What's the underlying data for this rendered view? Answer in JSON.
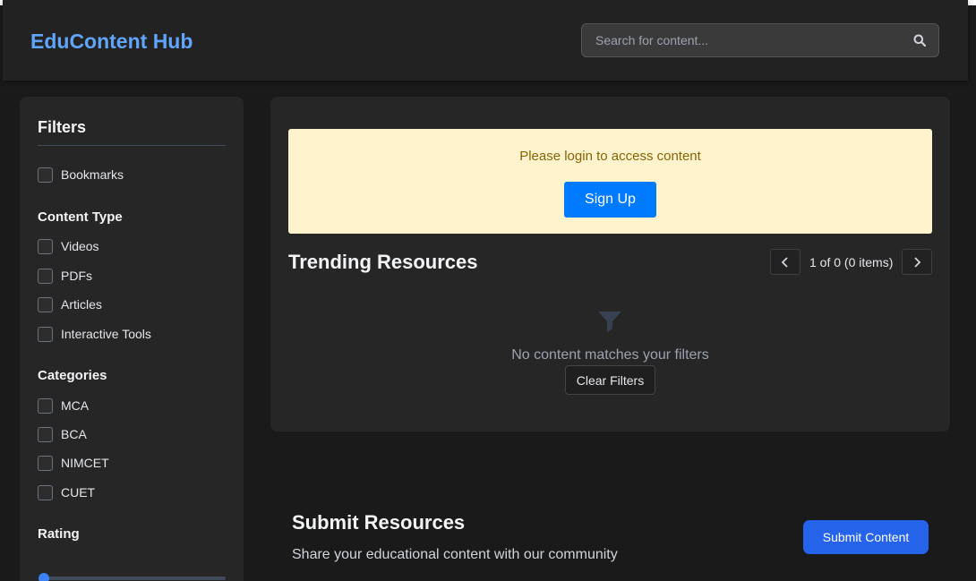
{
  "header": {
    "brand": "EduContent Hub",
    "search_placeholder": "Search for content...",
    "search_icon": "search-icon"
  },
  "sidebar": {
    "title": "Filters",
    "bookmarks_label": "Bookmarks",
    "content_type": {
      "heading": "Content Type",
      "items": [
        "Videos",
        "PDFs",
        "Articles",
        "Interactive Tools"
      ]
    },
    "categories": {
      "heading": "Categories",
      "items": [
        "MCA",
        "BCA",
        "NIMCET",
        "CUET"
      ]
    },
    "rating": {
      "heading": "Rating"
    }
  },
  "main": {
    "alert": {
      "message": "Please login to access content",
      "button_label": "Sign Up"
    },
    "trending": {
      "title": "Trending Resources",
      "pagination_text": "1 of 0 (0 items)"
    },
    "empty_state": {
      "icon": "funnel-icon",
      "message": "No content matches your filters",
      "clear_label": "Clear Filters"
    }
  },
  "submit": {
    "title": "Submit Resources",
    "subtitle": "Share your educational content with our community",
    "button_label": "Submit Content"
  },
  "colors": {
    "brand": "#60a5fa",
    "alert_bg": "#fff3cd",
    "alert_text": "#856404",
    "primary": "#007bff",
    "submit": "#2563eb"
  }
}
